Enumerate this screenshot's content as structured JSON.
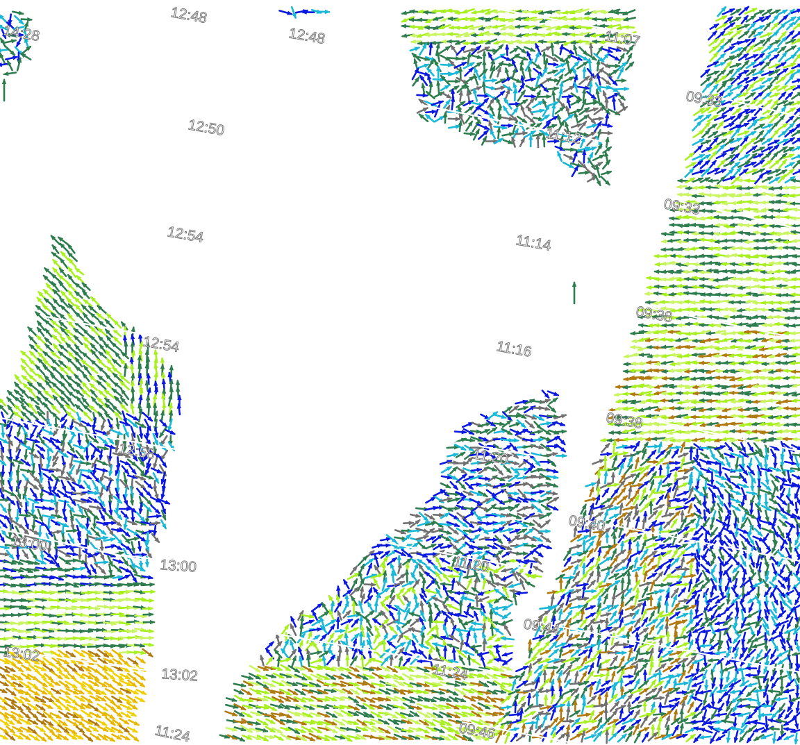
{
  "palette": {
    "dark_green": "#2e7d4f",
    "lime": "#a8f020",
    "light_lime": "#c8f560",
    "blue": "#0b18e0",
    "cyan": "#1ab8d8",
    "grey": "#707070",
    "brown": "#b07a10",
    "gold": "#e8b800",
    "yellow": "#f0d000"
  },
  "time_labels": [
    "12:48",
    "12:48",
    "12:50",
    "12:54",
    "12:54",
    "12:58",
    "13:00",
    "13:00",
    "13:02",
    "13:02",
    "11:24",
    "11:07",
    "11:12",
    "11:14",
    "11:16",
    "11:20",
    "11:20",
    "11:24",
    "09:33",
    "09:33",
    "09:38",
    "09:38",
    "09:40",
    "09:44",
    "09:46",
    "14:28"
  ]
}
